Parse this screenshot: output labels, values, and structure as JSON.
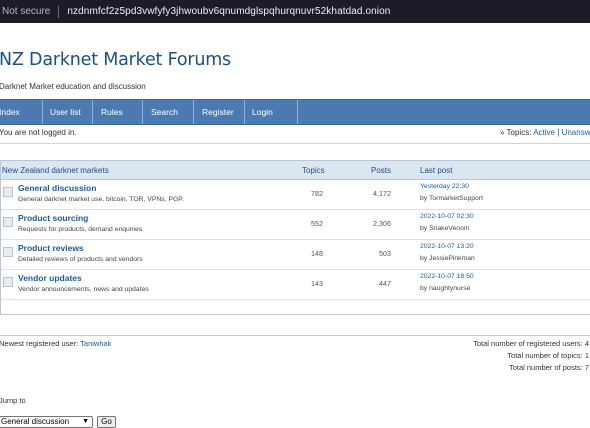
{
  "browser": {
    "security_label": "Not secure",
    "url": "nzdnmfcf2z5pd3vwfyfy3jhwoubv6qnumdglspqhurqnuvr52khatdad.onion"
  },
  "header": {
    "title": "NZ Darknet Market Forums",
    "subtitle": "Darknet Market education and discussion"
  },
  "nav": [
    "Index",
    "User list",
    "Rules",
    "Search",
    "Register",
    "Login"
  ],
  "status": {
    "login_text": "You are not logged in.",
    "topics_prefix": "Topics:",
    "active_link": "Active",
    "unanswered_link": "Unanswered"
  },
  "category": {
    "name": "New Zealand darknet markets",
    "col_topics": "Topics",
    "col_posts": "Posts",
    "col_last_post": "Last post"
  },
  "forums": [
    {
      "name": "General discussion",
      "description": "General darknet market use, bitcoin, TOR, VPNs, PGP.",
      "topics": "782",
      "posts": "4,172",
      "last_post_date": "Yesterday 22:30",
      "by": "by",
      "last_post_user": "TormarketSupport"
    },
    {
      "name": "Product sourcing",
      "description": "Requests for products, demand enquiries",
      "topics": "552",
      "posts": "2,306",
      "last_post_date": "2022-10-07 02:30",
      "by": "by",
      "last_post_user": "SnakeVenom"
    },
    {
      "name": "Product reviews",
      "description": "Detailed reviews of products and vendors",
      "topics": "148",
      "posts": "503",
      "last_post_date": "2022-10-07 13:20",
      "by": "by",
      "last_post_user": "JessiePinkman"
    },
    {
      "name": "Vendor updates",
      "description": "Vendor announcements, news and updates",
      "topics": "143",
      "posts": "447",
      "last_post_date": "2022-10-07 18:50",
      "by": "by",
      "last_post_user": "naughtynurse"
    }
  ],
  "stats": {
    "newest_label": "Newest registered user:",
    "newest_user": "Taniwhak",
    "registered_users": "Total number of registered users: 4",
    "topics": "Total number of topics: 1",
    "posts": "Total number of posts: 7"
  },
  "jump": {
    "label": "Jump to",
    "selected": "General discussion",
    "go_label": "Go"
  }
}
